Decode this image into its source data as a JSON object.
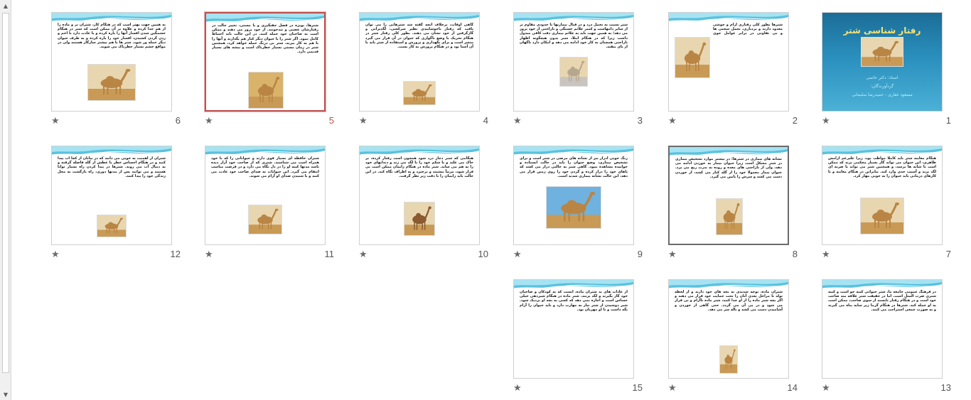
{
  "app": {
    "view": "Slide Sorter"
  },
  "slides": [
    {
      "n": "1",
      "title": "رفتار شناسی شتر",
      "lines": [
        "استاد: دکتر حاتمی",
        "گردآورندگان:",
        "مسعود غفاری - حمیدرضا سلیمانی"
      ],
      "image": "camel-face"
    },
    {
      "n": "2",
      "text": "شترها بطور کلی رفتاری آرام و خوشی معدود دارند و بردباری، تحمل سختی ها و بی تفاوتی در برابر عوامل جوی نامناسب از ویژگیهای آنها به شمار می آید. این حیوانات در دشوارترین شرایط آب و هوایی، بی غذایی و بی آبی به کار خود ادامه می دهند و این کار را تا آخرین رمق بالعینه خود ادامه می دهند. شتر ماده معمولا آرامتر از شتر نر می باشد.",
      "image": "camel-standing"
    },
    {
      "n": "3",
      "text": "شتر نسبت به تحمل درد و در قبال بیماریها تا حدودی مقاوم تر از سایر دامهاست و کمتر علائم خستگی و ناراحتی از خود بروز می دهد؛ به همین جهت باید به علائم بیماری دقت کافی مبذول داشت زیرا که در هنگام ابتلا، شتر بدون هیچگونه اظهار ناراحتی همچنان به کار خود ادامه می دهد و امکان دارد ناگهان از پای بیفتد.",
      "image": "camel-grey"
    },
    {
      "n": "4",
      "text": "گاهی اوقات، برخلاف آنچه گفته شد شترهایی را می توان یافت که رفتار ناخوشایندی نظیر سرکشی، لگدپرانی و گازگرفتن از خود نشان می دهند. بطور کلی رفتار شتر در هنگام تحریک یا وضع ناگواری که حیوان در آن قرار می گیرد متغیر است و برای نگهداری و پرورش و استفاده از شتر باید با آن آشنا بود و در هنگام پرورش به کار بست.",
      "image": "camels-group"
    },
    {
      "n": "5",
      "text": "شترها، بویژه در فصل جفتگیری و یا مستی، تغییر حالت در رفتارشان عصبی و تندخوتند. از خود بروز می دهند و ممکن است به صاحبان خود حمله کنند. در این حالت باید احتیاط کامل نمود. اگر شتر را با حیوان دیگر کنار هم بگذارند و آنها را با هم به کار ببرند، شتر بی درنگ حمله خواهد کرد، همچنین شتر در زمان مستی بسیار خطرناک است و بیشه های بسیار قدیمی دارد.",
      "image": "camel-desert"
    },
    {
      "n": "6",
      "text": "به همین جهت بهتر است که در هنگام کار، شتران نر و ماده را از هم جدا کرده و علاوه بر آن ممکن است که شتر در هنگام خشمگین شدن افسار آنها را پاره کرده و یا عادت دارد با اخم و زدن گردن کشیدن، افسار خود را پاره کرده و به طرف حیوان دیگر حمله ور شود. شتر ها با هم بیشتر سازگار هستند ولی در مواقع خشم بسیار خطرناک می شوند.",
      "image": "camel-lying"
    },
    {
      "n": "7",
      "text": "هنگام معاینه شتر باید کاملا مواظب بود، زیرا علیرغم آرامش ظاهری، این حیوان می تواند گاز بسیار محکمی بزند که ممکن است تا شانه ها برسد، و همچنین شتر می تواند با ضربه ای لگد بزند و آسیب جدی وارد کند. بنابراین در هنگام معاینه و یا کارهای درمانی باید حیوان را به خوبی مهار کرد.",
      "image": "camel-smile"
    },
    {
      "n": "8",
      "text": "نشانه های بیماری در شترها: در بیشتر موارد تشخیص بیماری در شتر مشکل است زیرا حیوان بیمار به خوردن ادامه می دهد، ولی از ناراحتی های معده و روده به ندرت رنج می برد. حیوان بیمار معمولا خود را از گله کنار می کشد، از خوردن دست می کشد و سرش را پایین می گیرد.",
      "image": "camel-young"
    },
    {
      "n": "9",
      "text": "رنگ خونی ادرار نیز از نشانه های مرضی در شتر است و برای تشخیص بیماری، وضع حیوان را باید در حالت ایستاده و خوابیده مشاهده نمود. گاهی شتر به حالتی دراز می کشد که پاهای خود را دراز کرده و گردن خود را روی زمین قرار می دهد، این حالت نشانه بیماری شدید است.",
      "image": "camel-sky"
    },
    {
      "n": "10",
      "text": "هنگامی که شتر دچار درد شود همچون اسب رفتار کرده، بر خاک می غلتد و یا شکم خود را با لگد می زند و دندانهای خود را به هم می ساید. شتر ماده در هنگام زایمان ممکن است بی قرار شود، مرتباً بنشیند و برخیزد و به اطراف نگاه کند. در این حالت باید زایمان را با دقت زیر نظر گرفت.",
      "image": "camel-brown"
    },
    {
      "n": "11",
      "text": "شتران حافظه ای بسیار قوی دارند و حیواناتی را که با خود همراه است می شناسند. شتری که از صاحب خود آزار دیده باشد مدتها کینه او را در دل نگاه می دارد و در فرصت مناسب انتقام می گیرد. این حیوانات به صدای صاحب خود عادت می کنند و با شنیدن صدای او آرام می شوند.",
      "image": "camel-closeup"
    },
    {
      "n": "12",
      "text": "شتران ار اهمیت به خوبی می دانند که در بیابان از کجا آب پیدا کنند و در هنگام احساس خطر یا عطش از گله فاصله گرفته و به دنبال آب می روند. شترها در پیدا کردن راه بسیار توانا هستند و می توانند پس از مدتها دوری، راه بازگشت به محل زندگی خود را پیدا کنند.",
      "image": "camel-walking"
    },
    {
      "n": "13",
      "text": "در فرهنگ عمومی جامعه ما، شتر حیوانی کینه جو است و کینه شتری ضرب المثل است. اما در حقیقت شتر علاقه مند صاحب خود است و در هنگام رفتار ناپسند از سوی صاحب، ممکن است به او حمله کند. شترها در هنگام گرما زیر سایه پناه می گیرند و به صورت جمعی استراحت می کنند.",
      "image": ""
    },
    {
      "n": "14",
      "text": "شتران ماده، توجه شدیدی به بچه های خود دارند و از لحظه تولد تا مراحل بعدی آنان را تحت حمایت خود قرار می دهند و اگر بچه شتر ماده را از او جدا کنند، شتر ماده ناآرام و بی قرار می شود و در پی آن می گردد. حتی گاهی از خوردن و آشامیدن دست می کشد و ناله سر می دهد.",
      "image": "camel-mother"
    },
    {
      "n": "15",
      "text": "از عادات های بد شتران ماده، آنست که به کودکان و صاحبان خود گاز بگیرند و لگد بزنند. شتر ماده در هنگام شیردهی خیلی حساس است و اجازه نمی دهد که کسی به بچه او نزدیک شود. شیر دوشیدن از شتر نیاز به مهارت دارد و باید حیوان را آرام نگه داشت و با او مهربان بود.",
      "image": ""
    }
  ],
  "icons": {
    "star": "transition-star-icon",
    "scroll_up": "scroll-up-icon",
    "scroll_down": "scroll-down-icon"
  }
}
